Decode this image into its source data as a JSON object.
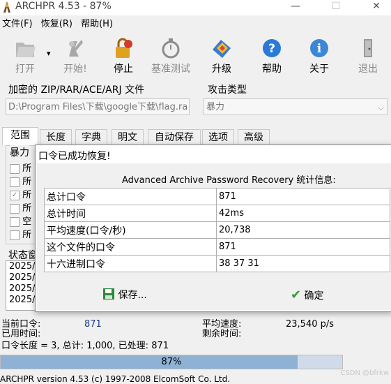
{
  "window": {
    "title": "ARCHPR 4.53 - 87%",
    "minimize": "—",
    "maximize": "☐",
    "close": "✕"
  },
  "menu": [
    "文件(F)",
    "恢复(R)",
    "帮助(H)"
  ],
  "toolbar": [
    {
      "label": "打开",
      "icon": "open-icon",
      "enabled": false
    },
    {
      "label": "开始!",
      "icon": "start-icon",
      "enabled": false
    },
    {
      "label": "停止",
      "icon": "stop-icon",
      "enabled": true
    },
    {
      "label": "基准测试",
      "icon": "stopwatch-icon",
      "enabled": false
    },
    {
      "label": "升级",
      "icon": "upgrade-icon",
      "enabled": true
    },
    {
      "label": "帮助",
      "icon": "help-icon",
      "enabled": true
    },
    {
      "label": "关于",
      "icon": "info-icon",
      "enabled": true
    },
    {
      "label": "退出",
      "icon": "exit-icon",
      "enabled": false
    }
  ],
  "toolbar_dropdown": "▾",
  "archive": {
    "label": "加密的 ZIP/RAR/ACE/ARJ 文件",
    "path": "D:\\Program Files\\下载\\google下载\\flag.ra"
  },
  "attack": {
    "label": "攻击类型",
    "value": "暴力",
    "arrow": "⌵"
  },
  "tabs": [
    "范围",
    "长度",
    "字典",
    "明文",
    "自动保存",
    "选项",
    "高级"
  ],
  "range_group": {
    "label": "暴力",
    "items": [
      {
        "label": "所",
        "checked": false
      },
      {
        "label": "所",
        "checked": false
      },
      {
        "label": "所",
        "checked": true
      },
      {
        "label": "所",
        "checked": false
      },
      {
        "label": "空",
        "checked": false
      },
      {
        "label": "所",
        "checked": false
      }
    ]
  },
  "status_window": {
    "label": "状态窗",
    "lines": [
      "2025/",
      "2025/",
      "2025/",
      "2025/"
    ]
  },
  "dialog": {
    "title": "口令已成功恢复!",
    "heading": "Advanced Archive Password Recovery 统计信息:",
    "rows": [
      {
        "key": "总计口令",
        "value": "871"
      },
      {
        "key": "总计时间",
        "value": "42ms"
      },
      {
        "key": "平均速度(口令/秒)",
        "value": "20,738"
      },
      {
        "key": "这个文件的口令",
        "value": "871"
      },
      {
        "key": "十六进制口令",
        "value": "38 37 31"
      }
    ],
    "save_label": "保存...",
    "ok_label": "确定",
    "check_glyph": "✔"
  },
  "status": {
    "current_label": "当前口令:",
    "current_value": "871",
    "elapsed_label": "已用时间:",
    "length_line": "口令长度 = 3, 总计: 1,000, 已处理: 871",
    "avg_label": "平均速度:",
    "avg_value": "23,540 p/s",
    "remaining_label": "剩余时间:"
  },
  "progress": {
    "percent": 87,
    "text": "87%"
  },
  "statusbar": "ARCHPR version 4.53 (c) 1997-2008 ElcomSoft Co. Ltd.",
  "watermark": "CSDN @bfrkw",
  "colors": {
    "progress_fill": "#8fb1d3",
    "progress_bg": "#cfdbe8",
    "check": "#2e9d2e",
    "save_icon": "#2a8a3a"
  }
}
